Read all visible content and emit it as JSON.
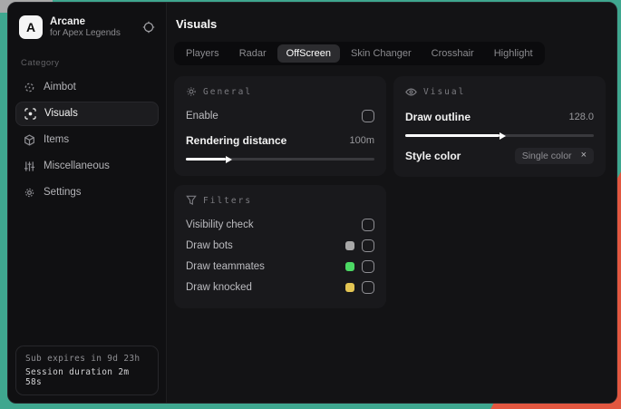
{
  "colors": {
    "desktop_teal": "#3fa78f",
    "desktop_orange": "#e25740",
    "accent_green_swatch": "#4cd964",
    "accent_yellow_swatch": "#e3c553",
    "accent_grey_swatch": "#a8a8a8"
  },
  "window": {
    "brand": {
      "initial": "A",
      "name": "Arcane",
      "subtitle": "for Apex Legends"
    },
    "sidebar": {
      "category_label": "Category",
      "items": [
        {
          "label": "Aimbot"
        },
        {
          "label": "Visuals",
          "selected": true
        },
        {
          "label": "Items"
        },
        {
          "label": "Miscellaneous"
        },
        {
          "label": "Settings"
        }
      ],
      "footer": {
        "line1": "Sub expires in 9d 23h",
        "line2": "Session duration 2m 58s"
      }
    },
    "main": {
      "title": "Visuals",
      "tabs": [
        {
          "label": "Players"
        },
        {
          "label": "Radar"
        },
        {
          "label": "OffScreen",
          "active": true
        },
        {
          "label": "Skin Changer"
        },
        {
          "label": "Crosshair"
        },
        {
          "label": "Highlight"
        }
      ],
      "panels": {
        "general": {
          "header": "General",
          "enable": {
            "label": "Enable",
            "checked": false
          },
          "rendering_distance": {
            "label": "Rendering distance",
            "value": "100m",
            "percent": 21
          }
        },
        "visual": {
          "header": "Visual",
          "draw_outline": {
            "label": "Draw outline",
            "value": "128.0",
            "percent": 50
          },
          "style_color": {
            "label": "Style color",
            "selected_option": "Single color",
            "clear_icon": "×"
          }
        },
        "filters": {
          "header": "Filters",
          "rows": [
            {
              "label": "Visibility check",
              "checked": false
            },
            {
              "label": "Draw bots",
              "swatch": "#a8a8a8",
              "checked": false
            },
            {
              "label": "Draw teammates",
              "swatch": "#4cd964",
              "checked": false
            },
            {
              "label": "Draw knocked",
              "swatch": "#e3c553",
              "checked": false
            }
          ]
        }
      }
    }
  }
}
